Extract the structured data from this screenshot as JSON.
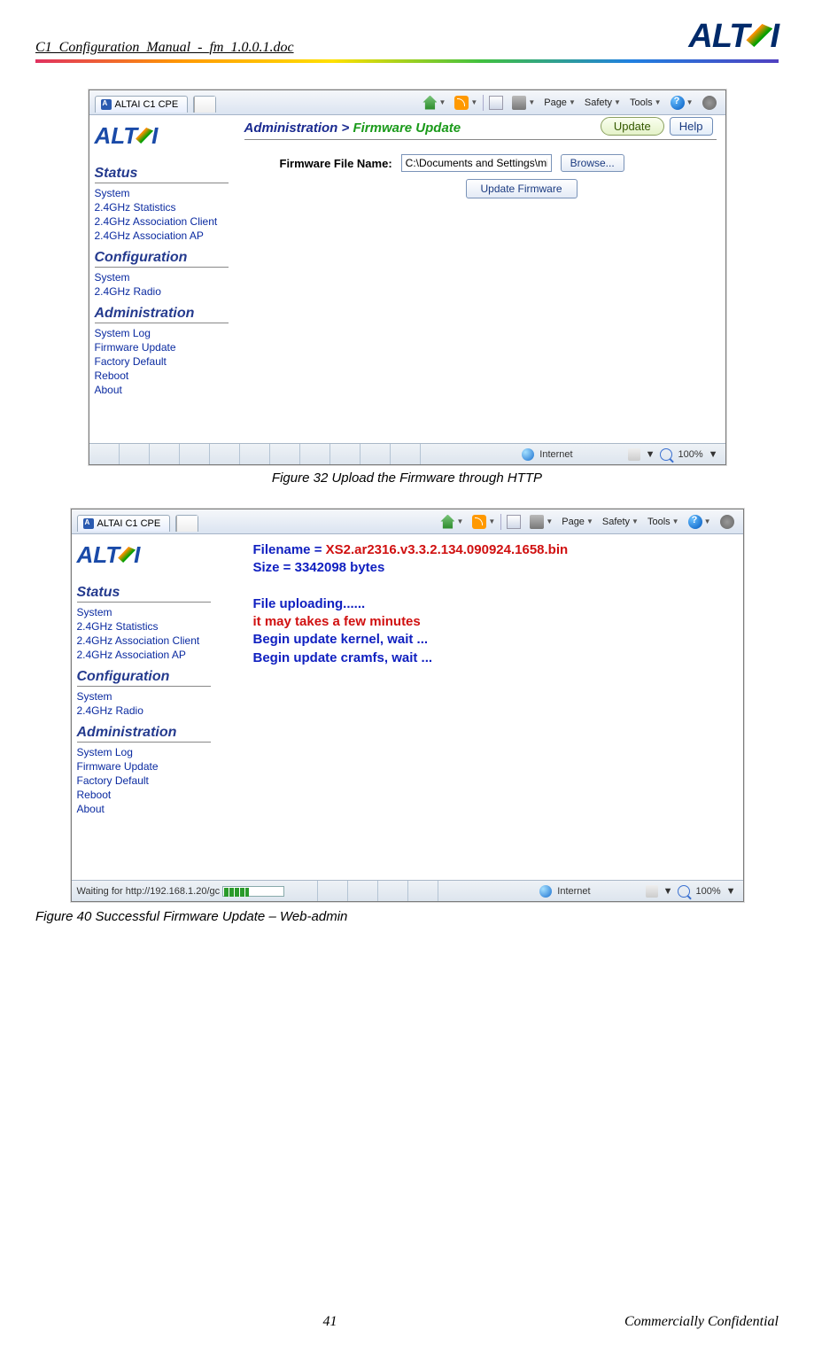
{
  "doc_header": "C1_Configuration_Manual_-_fm_1.0.0.1.doc",
  "brand": "ALTAI",
  "ie_tab_title": "ALTAI C1 CPE",
  "ie_toolbar": {
    "page": "Page",
    "safety": "Safety",
    "tools": "Tools"
  },
  "nav": {
    "status": "Status",
    "status_items": [
      "System",
      "2.4GHz Statistics",
      "2.4GHz Association Client",
      "2.4GHz Association AP"
    ],
    "config": "Configuration",
    "config_items": [
      "System",
      "2.4GHz Radio"
    ],
    "admin": "Administration",
    "admin_items": [
      "System Log",
      "Firmware Update",
      "Factory Default",
      "Reboot",
      "About"
    ]
  },
  "fig32": {
    "breadcrumb_root": "Administration >",
    "breadcrumb_current": "Firmware Update",
    "update_btn": "Update",
    "help_btn": "Help",
    "label": "Firmware File Name:",
    "input_value": "C:\\Documents and Settings\\mia",
    "browse_btn": "Browse...",
    "upfw_btn": "Update Firmware",
    "caption": "Figure 32    Upload the Firmware through HTTP",
    "status_zone": "Internet",
    "zoom": "100%"
  },
  "fig40": {
    "msg_filename": "Filename = XS2.ar2316.v3.3.2.134.090924.1658.bin",
    "msg_size": "Size = 3342098 bytes",
    "msg_uploading": "File uploading......",
    "msg_minutes": "it may takes a few minutes",
    "msg_kernel": "Begin update kernel, wait ...",
    "msg_cramfs": "Begin update cramfs, wait ...",
    "status_text": "Waiting for http://192.168.1.20/gc",
    "status_zone": "Internet",
    "zoom": "100%",
    "caption": "Figure 40    Successful Firmware Update – Web-admin"
  },
  "footer": {
    "page": "41",
    "conf": "Commercially Confidential"
  }
}
